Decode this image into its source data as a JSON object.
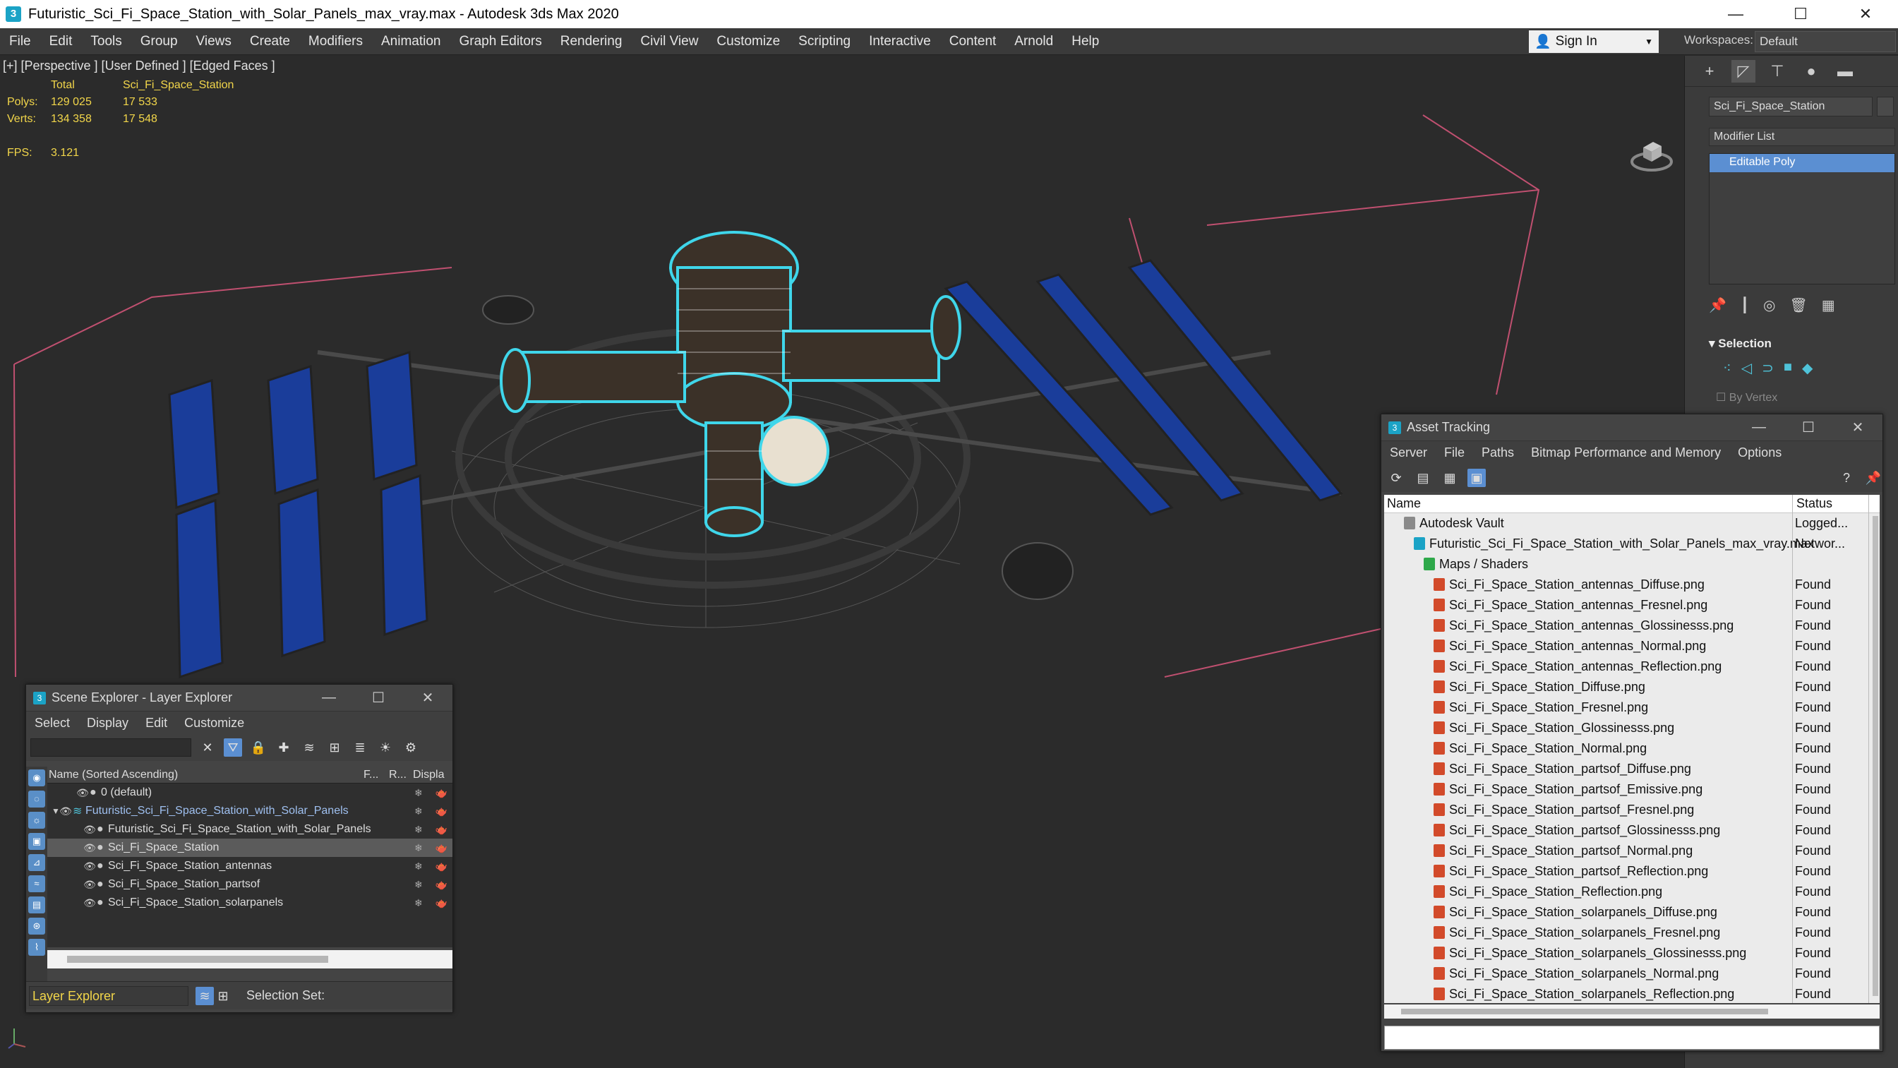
{
  "window": {
    "title": "Futuristic_Sci_Fi_Space_Station_with_Solar_Panels_max_vray.max - Autodesk 3ds Max 2020",
    "minimize": "—",
    "maximize": "☐",
    "close": "✕"
  },
  "menu": [
    "File",
    "Edit",
    "Tools",
    "Group",
    "Views",
    "Create",
    "Modifiers",
    "Animation",
    "Graph Editors",
    "Rendering",
    "Civil View",
    "Customize",
    "Scripting",
    "Interactive",
    "Content",
    "Arnold",
    "Help"
  ],
  "signin": {
    "label": "Sign In"
  },
  "workspaces": {
    "label": "Workspaces:",
    "value": "Default"
  },
  "viewport": {
    "label": "[+] [Perspective ] [User Defined ] [Edged Faces ]",
    "stats": {
      "col_total": "Total",
      "col_object": "Sci_Fi_Space_Station",
      "polys_label": "Polys:",
      "polys_total": "129 025",
      "polys_obj": "17 533",
      "verts_label": "Verts:",
      "verts_total": "134 358",
      "verts_obj": "17 548",
      "fps_label": "FPS:",
      "fps_value": "3.121"
    }
  },
  "command_panel": {
    "object_name": "Sci_Fi_Space_Station",
    "modifier_list": "Modifier List",
    "stack_item": "Editable Poly",
    "rollout": "Selection",
    "by_vertex": "By Vertex"
  },
  "scene_explorer": {
    "title": "Scene Explorer - Layer Explorer",
    "menu": [
      "Select",
      "Display",
      "Edit",
      "Customize"
    ],
    "col_name": "Name (Sorted Ascending)",
    "col_f": "F...",
    "col_r": "R...",
    "col_display": "Displa",
    "rows": [
      {
        "label": "0 (default)",
        "indent": 56
      },
      {
        "label": "Futuristic_Sci_Fi_Space_Station_with_Solar_Panels",
        "indent": 56,
        "layer": true
      },
      {
        "label": "Futuristic_Sci_Fi_Space_Station_with_Solar_Panels",
        "indent": 66
      },
      {
        "label": "Sci_Fi_Space_Station",
        "indent": 66,
        "selected": true
      },
      {
        "label": "Sci_Fi_Space_Station_antennas",
        "indent": 66
      },
      {
        "label": "Sci_Fi_Space_Station_partsof",
        "indent": 66
      },
      {
        "label": "Sci_Fi_Space_Station_solarpanels",
        "indent": 66
      }
    ],
    "layer_box": "Layer Explorer",
    "selection_set": "Selection Set:"
  },
  "asset_tracking": {
    "title": "Asset Tracking",
    "menu": [
      "Server",
      "File",
      "Paths",
      "Bitmap Performance and Memory",
      "Options"
    ],
    "col_name": "Name",
    "col_status": "Status",
    "rows": [
      {
        "name": "Autodesk Vault",
        "status": "Logged...",
        "icon": "vault",
        "indent": 28
      },
      {
        "name": "Futuristic_Sci_Fi_Space_Station_with_Solar_Panels_max_vray.max",
        "status": "Networ...",
        "icon": "max",
        "indent": 42
      },
      {
        "name": "Maps / Shaders",
        "status": "",
        "icon": "maps",
        "indent": 56
      },
      {
        "name": "Sci_Fi_Space_Station_antennas_Diffuse.png",
        "status": "Found",
        "icon": "file",
        "indent": 70
      },
      {
        "name": "Sci_Fi_Space_Station_antennas_Fresnel.png",
        "status": "Found",
        "icon": "file",
        "indent": 70
      },
      {
        "name": "Sci_Fi_Space_Station_antennas_Glossinesss.png",
        "status": "Found",
        "icon": "file",
        "indent": 70
      },
      {
        "name": "Sci_Fi_Space_Station_antennas_Normal.png",
        "status": "Found",
        "icon": "file",
        "indent": 70
      },
      {
        "name": "Sci_Fi_Space_Station_antennas_Reflection.png",
        "status": "Found",
        "icon": "file",
        "indent": 70
      },
      {
        "name": "Sci_Fi_Space_Station_Diffuse.png",
        "status": "Found",
        "icon": "file",
        "indent": 70
      },
      {
        "name": "Sci_Fi_Space_Station_Fresnel.png",
        "status": "Found",
        "icon": "file",
        "indent": 70
      },
      {
        "name": "Sci_Fi_Space_Station_Glossinesss.png",
        "status": "Found",
        "icon": "file",
        "indent": 70
      },
      {
        "name": "Sci_Fi_Space_Station_Normal.png",
        "status": "Found",
        "icon": "file",
        "indent": 70
      },
      {
        "name": "Sci_Fi_Space_Station_partsof_Diffuse.png",
        "status": "Found",
        "icon": "file",
        "indent": 70
      },
      {
        "name": "Sci_Fi_Space_Station_partsof_Emissive.png",
        "status": "Found",
        "icon": "file",
        "indent": 70
      },
      {
        "name": "Sci_Fi_Space_Station_partsof_Fresnel.png",
        "status": "Found",
        "icon": "file",
        "indent": 70
      },
      {
        "name": "Sci_Fi_Space_Station_partsof_Glossinesss.png",
        "status": "Found",
        "icon": "file",
        "indent": 70
      },
      {
        "name": "Sci_Fi_Space_Station_partsof_Normal.png",
        "status": "Found",
        "icon": "file",
        "indent": 70
      },
      {
        "name": "Sci_Fi_Space_Station_partsof_Reflection.png",
        "status": "Found",
        "icon": "file",
        "indent": 70
      },
      {
        "name": "Sci_Fi_Space_Station_Reflection.png",
        "status": "Found",
        "icon": "file",
        "indent": 70
      },
      {
        "name": "Sci_Fi_Space_Station_solarpanels_Diffuse.png",
        "status": "Found",
        "icon": "file",
        "indent": 70
      },
      {
        "name": "Sci_Fi_Space_Station_solarpanels_Fresnel.png",
        "status": "Found",
        "icon": "file",
        "indent": 70
      },
      {
        "name": "Sci_Fi_Space_Station_solarpanels_Glossinesss.png",
        "status": "Found",
        "icon": "file",
        "indent": 70
      },
      {
        "name": "Sci_Fi_Space_Station_solarpanels_Normal.png",
        "status": "Found",
        "icon": "file",
        "indent": 70
      },
      {
        "name": "Sci_Fi_Space_Station_solarpanels_Reflection.png",
        "status": "Found",
        "icon": "file",
        "indent": 70
      }
    ]
  }
}
